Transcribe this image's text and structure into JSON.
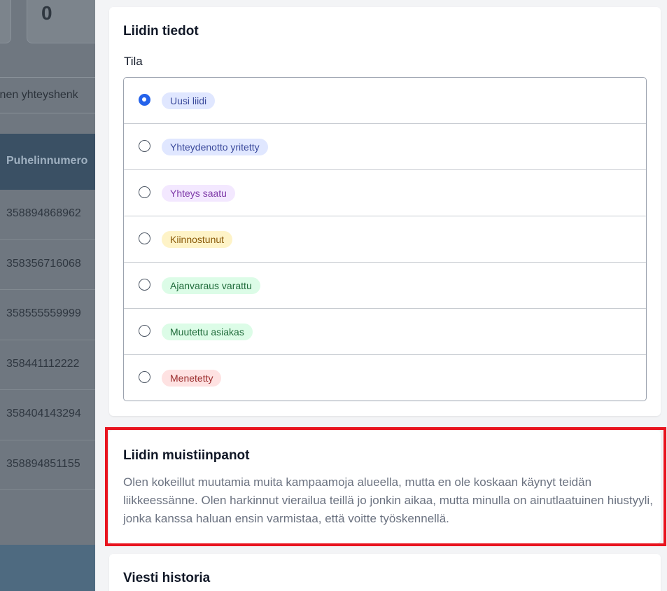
{
  "background": {
    "stat_value": "0",
    "search_placeholder": "inen yhteyshenk",
    "table_header": "Puhelinnumero",
    "phone_numbers": [
      "358894868962",
      "358356716068",
      "358555559999",
      "358441112222",
      "358404143294",
      "358894851155"
    ]
  },
  "lead_details": {
    "title": "Liidin tiedot",
    "status_label": "Tila",
    "statuses": [
      {
        "label": "Uusi liidi",
        "selected": true,
        "bg": "#e0e7ff",
        "fg": "#3b4a9c"
      },
      {
        "label": "Yhteydenotto yritetty",
        "selected": false,
        "bg": "#e0e7ff",
        "fg": "#3b4a9c"
      },
      {
        "label": "Yhteys saatu",
        "selected": false,
        "bg": "#f3e8ff",
        "fg": "#7e3aa8"
      },
      {
        "label": "Kiinnostunut",
        "selected": false,
        "bg": "#fef3c7",
        "fg": "#8a5a0a"
      },
      {
        "label": "Ajanvaraus varattu",
        "selected": false,
        "bg": "#dcfce7",
        "fg": "#1f6b3a"
      },
      {
        "label": "Muutettu asiakas",
        "selected": false,
        "bg": "#dcfce7",
        "fg": "#1f6b3a"
      },
      {
        "label": "Menetetty",
        "selected": false,
        "bg": "#fee2e2",
        "fg": "#9b2c2c"
      }
    ]
  },
  "lead_notes": {
    "title": "Liidin muistiinpanot",
    "text": "Olen kokeillut muutamia muita kampaamoja alueella, mutta en ole koskaan käynyt teidän liikkeessänne. Olen harkinnut vierailua teillä jo jonkin aikaa, mutta minulla on ainutlaatuinen hiustyyli, jonka kanssa haluan ensin varmistaa, että voitte työskennellä."
  },
  "message_history": {
    "title": "Viesti historia"
  },
  "colors": {
    "accent": "#2563eb",
    "highlight": "#e8141f"
  }
}
